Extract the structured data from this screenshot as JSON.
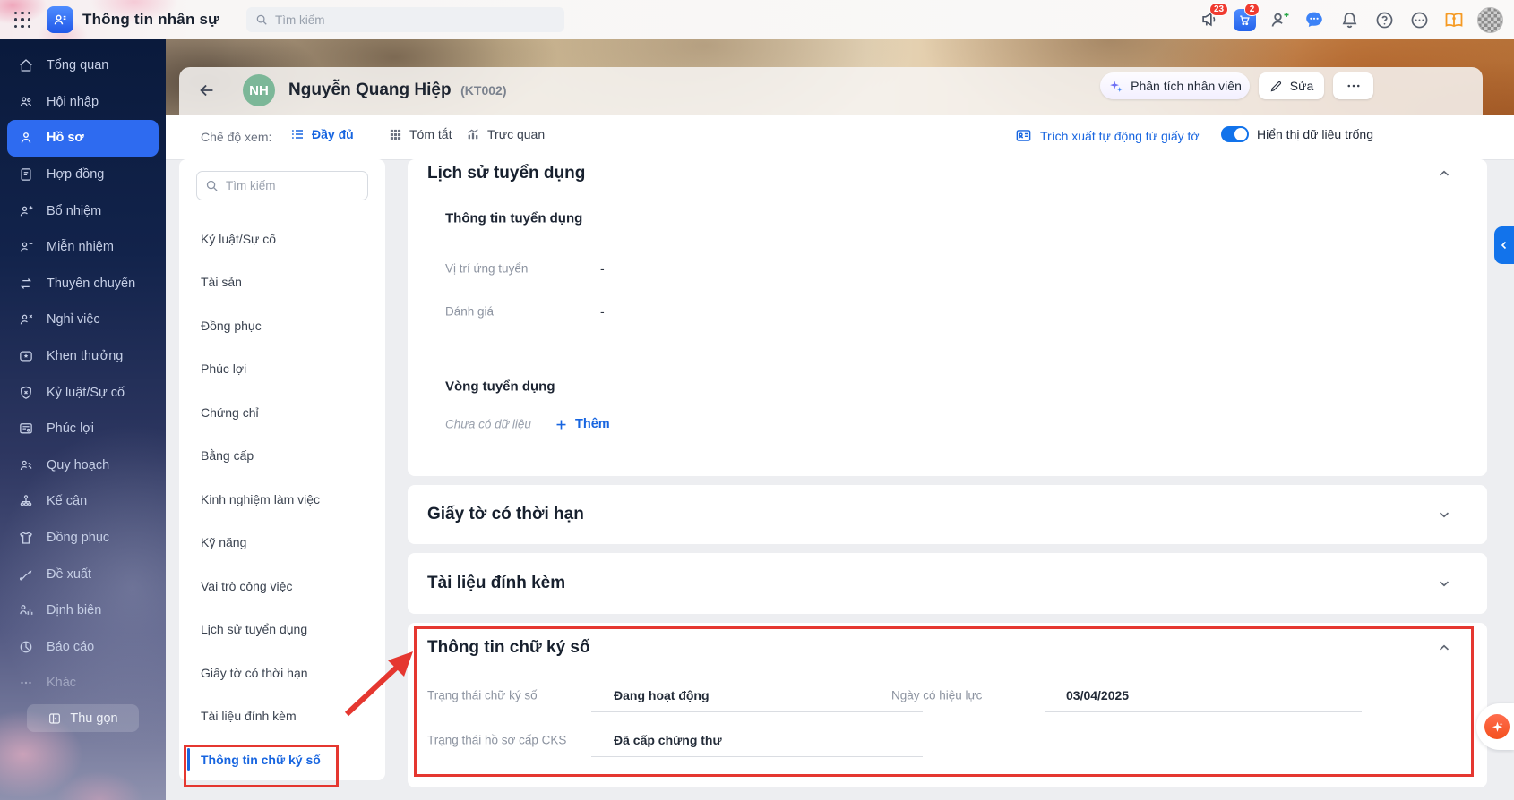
{
  "topbar": {
    "title": "Thông tin nhân sự",
    "search_placeholder": "Tìm kiếm",
    "badges": {
      "megaphone": "23",
      "cart": "2"
    },
    "icons": [
      "grid-menu-icon",
      "app-logo-icon",
      "megaphone-icon",
      "store-cart-icon",
      "add-user-icon",
      "chat-icon",
      "bell-icon",
      "help-icon",
      "more-circle-icon",
      "handbook-icon",
      "avatar"
    ]
  },
  "sidebar": {
    "items": [
      {
        "label": "Tổng quan",
        "icon": "home-icon",
        "active": false
      },
      {
        "label": "Hội nhập",
        "icon": "people-icon",
        "active": false
      },
      {
        "label": "Hồ sơ",
        "icon": "person-icon",
        "active": true
      },
      {
        "label": "Hợp đồng",
        "icon": "document-icon",
        "active": false
      },
      {
        "label": "Bổ nhiệm",
        "icon": "person-plus-icon",
        "active": false
      },
      {
        "label": "Miễn nhiệm",
        "icon": "person-minus-icon",
        "active": false
      },
      {
        "label": "Thuyên chuyển",
        "icon": "transfer-icon",
        "active": false
      },
      {
        "label": "Nghỉ việc",
        "icon": "person-x-icon",
        "active": false
      },
      {
        "label": "Khen thưởng",
        "icon": "award-icon",
        "active": false
      },
      {
        "label": "Kỷ luật/Sự cố",
        "icon": "shield-x-icon",
        "active": false
      },
      {
        "label": "Phúc lợi",
        "icon": "benefit-icon",
        "active": false
      },
      {
        "label": "Quy hoạch",
        "icon": "planning-icon",
        "active": false
      },
      {
        "label": "Kế cận",
        "icon": "org-chart-icon",
        "active": false
      },
      {
        "label": "Đồng phục",
        "icon": "shirt-icon",
        "active": false
      },
      {
        "label": "Đề xuất",
        "icon": "proposal-icon",
        "active": false
      },
      {
        "label": "Định biên",
        "icon": "headcount-icon",
        "active": false
      },
      {
        "label": "Báo cáo",
        "icon": "report-icon",
        "active": false
      },
      {
        "label": "Khác",
        "icon": "more-icon",
        "active": false
      }
    ],
    "collapse_label": "Thu gọn"
  },
  "header": {
    "avatar_initials": "NH",
    "name": "Nguyễn Quang Hiệp",
    "code": "(KT002)",
    "analyze_button": "Phân tích nhân viên",
    "edit_button": "Sửa",
    "more_button": "..."
  },
  "viewbar": {
    "label": "Chế độ xem:",
    "modes": [
      {
        "label": "Đầy đủ",
        "icon": "list-view-icon",
        "active": true
      },
      {
        "label": "Tóm tắt",
        "icon": "grid-view-icon",
        "active": false
      },
      {
        "label": "Trực quan",
        "icon": "chart-view-icon",
        "active": false
      }
    ],
    "extract_link": "Trích xuất tự động từ giấy tờ",
    "toggle_label": "Hiển thị dữ liệu trống",
    "toggle_on": true
  },
  "profile_nav": {
    "search_placeholder": "Tìm kiếm",
    "items": [
      "Kỷ luật/Sự cố",
      "Tài sản",
      "Đồng phục",
      "Phúc lợi",
      "Chứng chỉ",
      "Bằng cấp",
      "Kinh nghiệm làm việc",
      "Kỹ năng",
      "Vai trò công việc",
      "Lịch sử tuyển dụng",
      "Giấy tờ có thời hạn",
      "Tài liệu đính kèm",
      "Thông tin chữ ký số"
    ],
    "active_item": "Thông tin chữ ký số"
  },
  "sections": {
    "recruitment": {
      "title": "Lịch sử tuyển dụng",
      "info_title": "Thông tin tuyển dụng",
      "fields": [
        {
          "label": "Vị trí ứng tuyển",
          "value": "-"
        },
        {
          "label": "Đánh giá",
          "value": "-"
        }
      ],
      "rounds_title": "Vòng tuyển dụng",
      "empty_text": "Chưa có dữ liệu",
      "add_label": "Thêm",
      "collapsed": false
    },
    "documents": {
      "title": "Giấy tờ có thời hạn",
      "collapsed": true
    },
    "attachments": {
      "title": "Tài liệu đính kèm",
      "collapsed": true
    },
    "digital_signature": {
      "title": "Thông tin chữ ký số",
      "collapsed": false,
      "fields": [
        {
          "label": "Trạng thái chữ ký số",
          "value": "Đang hoạt động"
        },
        {
          "label": "Ngày có hiệu lực",
          "value": "03/04/2025"
        },
        {
          "label": "Trạng thái hồ sơ cấp CKS",
          "value": "Đã cấp chứng thư"
        }
      ]
    }
  },
  "colors": {
    "accent_blue": "#1765e0",
    "sidebar_active": "#2e6bf0",
    "annotation_red": "#e53730",
    "badge_red": "#f03b30",
    "toggle_on": "#1273eb",
    "avatar_green": "#7cb798",
    "fab_orange": "#f4511e"
  }
}
